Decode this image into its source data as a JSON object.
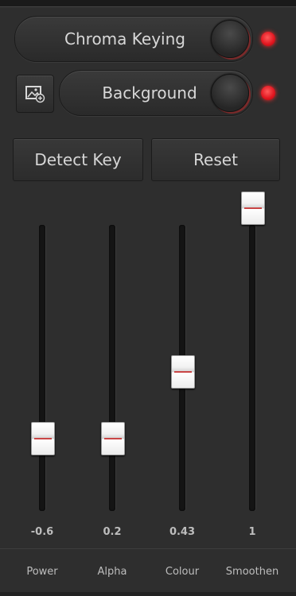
{
  "chroma": {
    "label": "Chroma Keying",
    "state": "on",
    "led_color": "#e0141e"
  },
  "background": {
    "label": "Background",
    "state": "on",
    "led_color": "#e0141e",
    "image_button_icon": "image-add-icon"
  },
  "buttons": {
    "detect_key": "Detect Key",
    "reset": "Reset"
  },
  "sliders": [
    {
      "name": "Power",
      "value": "-0.6",
      "level": 0.25
    },
    {
      "name": "Alpha",
      "value": "0.2",
      "level": 0.25
    },
    {
      "name": "Colour",
      "value": "0.43",
      "level": 0.5
    },
    {
      "name": "Smoothen",
      "value": "1",
      "level": 1.0
    }
  ],
  "colors": {
    "background": "#2e2e2e",
    "track": "#141414",
    "thumb": "#f2f2f2",
    "accent": "#c94545"
  }
}
